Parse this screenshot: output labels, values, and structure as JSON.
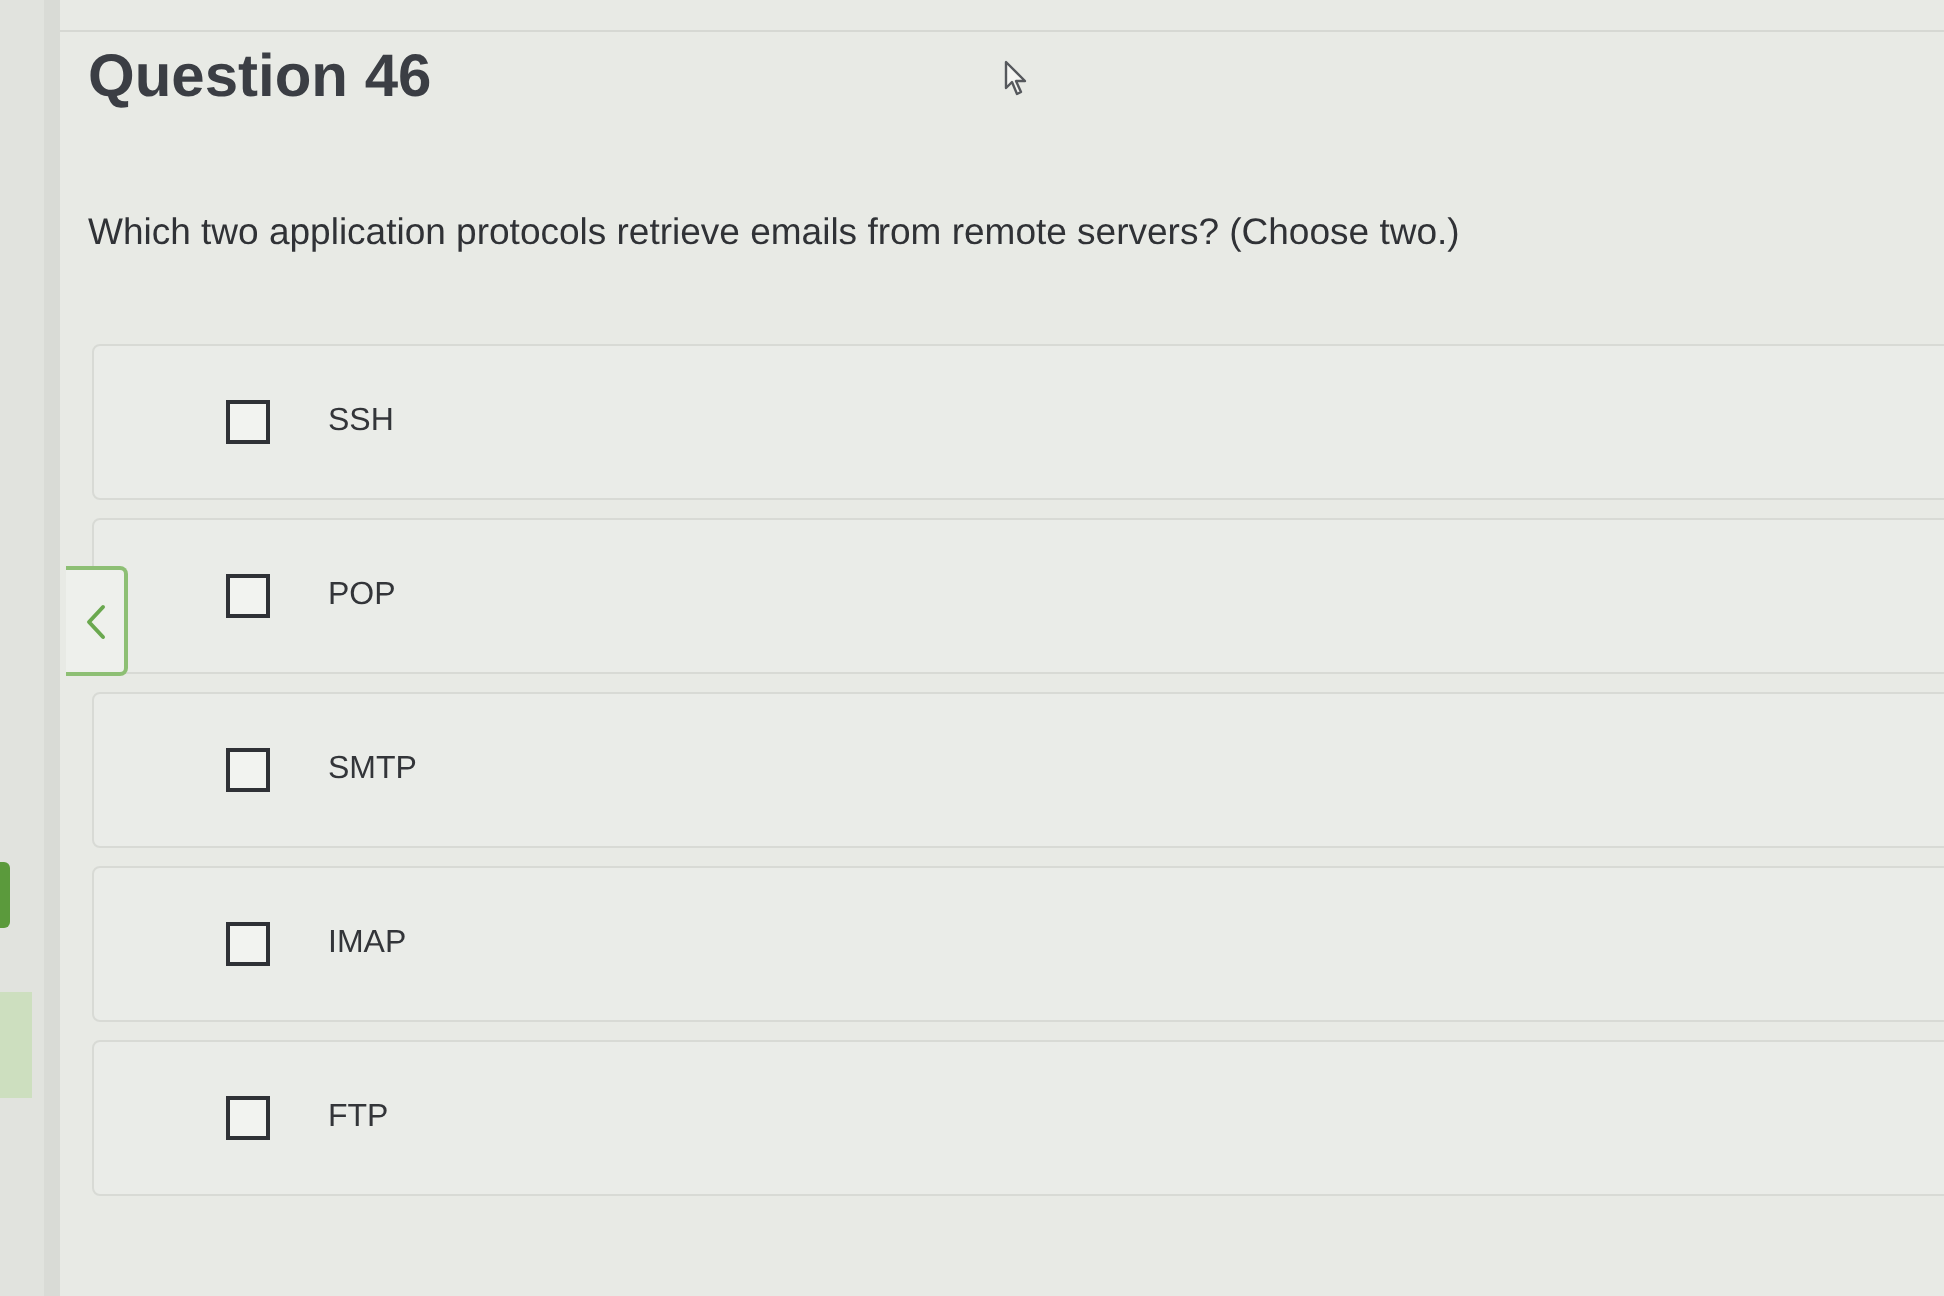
{
  "question": {
    "title": "Question 46",
    "prompt": "Which two application protocols retrieve emails from remote servers? (Choose two.)"
  },
  "options": [
    {
      "label": "SSH",
      "checked": false
    },
    {
      "label": "POP",
      "checked": false
    },
    {
      "label": "SMTP",
      "checked": false
    },
    {
      "label": "IMAP",
      "checked": false
    },
    {
      "label": "FTP",
      "checked": false
    }
  ]
}
